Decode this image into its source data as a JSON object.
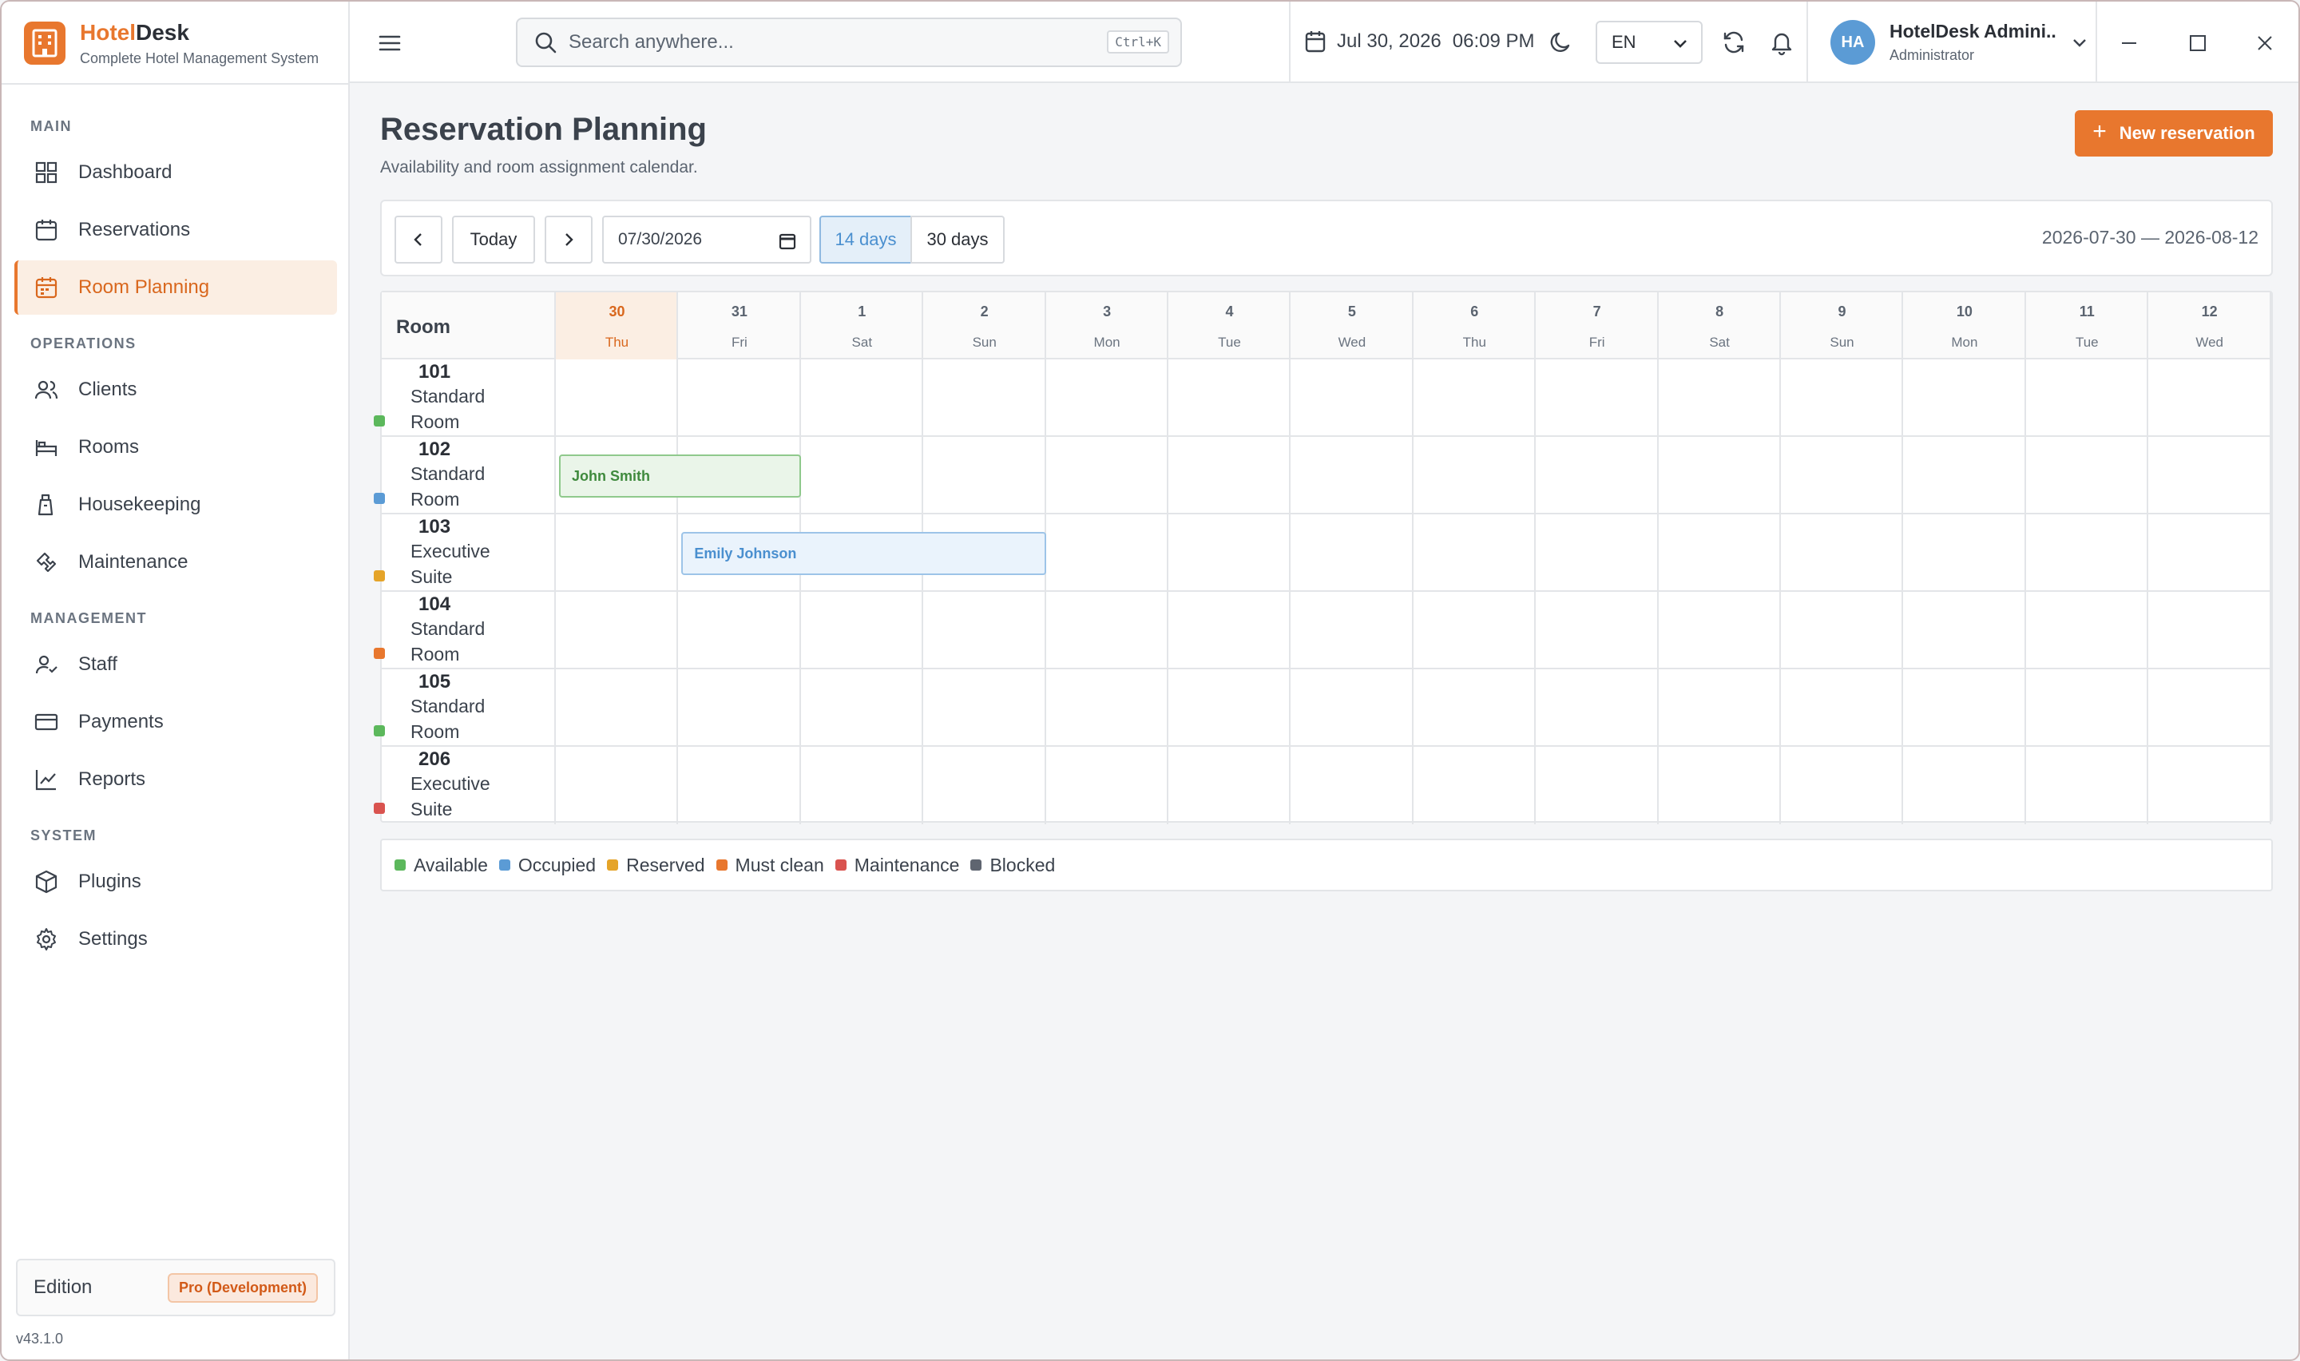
{
  "brand": {
    "name_part1": "Hotel",
    "name_part2": "Desk",
    "subtitle": "Complete Hotel Management System"
  },
  "sidebar": {
    "sections": [
      {
        "title": "MAIN",
        "items": [
          {
            "label": "Dashboard",
            "icon": "dashboard-icon"
          },
          {
            "label": "Reservations",
            "icon": "calendar-icon"
          },
          {
            "label": "Room Planning",
            "icon": "calendar-grid-icon",
            "active": true
          }
        ]
      },
      {
        "title": "OPERATIONS",
        "items": [
          {
            "label": "Clients",
            "icon": "users-icon"
          },
          {
            "label": "Rooms",
            "icon": "bed-icon"
          },
          {
            "label": "Housekeeping",
            "icon": "housekeeping-icon"
          },
          {
            "label": "Maintenance",
            "icon": "wrench-icon"
          }
        ]
      },
      {
        "title": "MANAGEMENT",
        "items": [
          {
            "label": "Staff",
            "icon": "staff-icon"
          },
          {
            "label": "Payments",
            "icon": "credit-card-icon"
          },
          {
            "label": "Reports",
            "icon": "chart-line-icon"
          }
        ]
      },
      {
        "title": "SYSTEM",
        "items": [
          {
            "label": "Plugins",
            "icon": "package-icon"
          },
          {
            "label": "Settings",
            "icon": "gear-icon"
          }
        ]
      }
    ],
    "edition_label": "Edition",
    "edition_value": "Pro (Development)",
    "version": "v43.1.0"
  },
  "topbar": {
    "search_placeholder": "Search anywhere...",
    "search_shortcut": "Ctrl+K",
    "date": "Jul 30, 2026",
    "time": "06:09 PM",
    "language": "EN",
    "user_initials": "HA",
    "user_name": "HotelDesk Admini...",
    "user_role": "Administrator"
  },
  "page": {
    "title": "Reservation Planning",
    "subtitle": "Availability and room assignment calendar.",
    "new_button": "New reservation"
  },
  "toolbar": {
    "today_label": "Today",
    "date_value": "07/30/2026",
    "range_14": "14 days",
    "range_30": "30 days",
    "range_label": "2026-07-30 — 2026-08-12"
  },
  "grid": {
    "room_header": "Room",
    "days": [
      {
        "num": "30",
        "dow": "Thu",
        "today": true
      },
      {
        "num": "31",
        "dow": "Fri"
      },
      {
        "num": "1",
        "dow": "Sat"
      },
      {
        "num": "2",
        "dow": "Sun"
      },
      {
        "num": "3",
        "dow": "Mon"
      },
      {
        "num": "4",
        "dow": "Tue"
      },
      {
        "num": "5",
        "dow": "Wed"
      },
      {
        "num": "6",
        "dow": "Thu"
      },
      {
        "num": "7",
        "dow": "Fri"
      },
      {
        "num": "8",
        "dow": "Sat"
      },
      {
        "num": "9",
        "dow": "Sun"
      },
      {
        "num": "10",
        "dow": "Mon"
      },
      {
        "num": "11",
        "dow": "Tue"
      },
      {
        "num": "12",
        "dow": "Wed"
      }
    ],
    "rooms": [
      {
        "number": "101",
        "type_line1": "Standard",
        "type_line2": "Room",
        "status_color": "#5cb85c"
      },
      {
        "number": "102",
        "type_line1": "Standard",
        "type_line2": "Room",
        "status_color": "#5b9bd5"
      },
      {
        "number": "103",
        "type_line1": "Executive",
        "type_line2": "Suite",
        "status_color": "#e5a429"
      },
      {
        "number": "104",
        "type_line1": "Standard",
        "type_line2": "Room",
        "status_color": "#e8772e"
      },
      {
        "number": "105",
        "type_line1": "Standard",
        "type_line2": "Room",
        "status_color": "#5cb85c"
      },
      {
        "number": "206",
        "type_line1": "Executive",
        "type_line2": "Suite",
        "status_color": "#d9534f"
      }
    ],
    "reservations": [
      {
        "guest": "John Smith",
        "room": "102",
        "start_day": 0,
        "nights": 2,
        "style": "green"
      },
      {
        "guest": "Emily Johnson",
        "room": "103",
        "start_day": 1,
        "nights": 3,
        "style": "blue"
      }
    ]
  },
  "legend": [
    {
      "label": "Available",
      "color": "#5cb85c"
    },
    {
      "label": "Occupied",
      "color": "#5b9bd5"
    },
    {
      "label": "Reserved",
      "color": "#e5a429"
    },
    {
      "label": "Must clean",
      "color": "#e8772e"
    },
    {
      "label": "Maintenance",
      "color": "#d9534f"
    },
    {
      "label": "Blocked",
      "color": "#5f6570"
    }
  ]
}
